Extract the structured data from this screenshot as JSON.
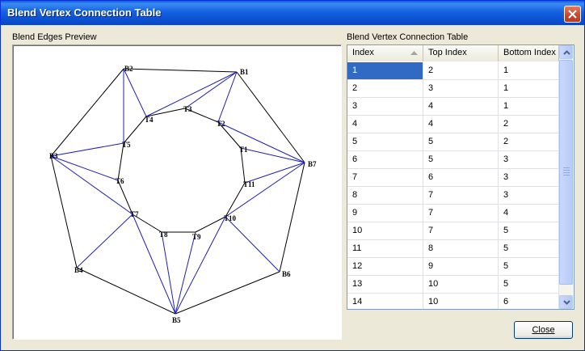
{
  "window": {
    "title": "Blend Vertex Connection Table",
    "close_icon": "close-icon"
  },
  "preview": {
    "label": "Blend Edges Preview",
    "bottom_vertices": [
      "B1",
      "B2",
      "B3",
      "B4",
      "B5",
      "B6",
      "B7"
    ],
    "top_vertices": [
      "T1",
      "T2",
      "T3",
      "T4",
      "T5",
      "T6",
      "T7",
      "T8",
      "T9",
      "T10",
      "T11"
    ],
    "colors": {
      "outline": "#000000",
      "connection": "#1f1fb8"
    }
  },
  "table": {
    "label": "Blend Vertex Connection Table",
    "columns": [
      "Index",
      "Top Index",
      "Bottom Index"
    ],
    "sort_icon": "sort-ascending-icon",
    "selected_row": 0,
    "rows": [
      [
        "1",
        "2",
        "1"
      ],
      [
        "2",
        "3",
        "1"
      ],
      [
        "3",
        "4",
        "1"
      ],
      [
        "4",
        "4",
        "2"
      ],
      [
        "5",
        "5",
        "2"
      ],
      [
        "6",
        "5",
        "3"
      ],
      [
        "7",
        "6",
        "3"
      ],
      [
        "8",
        "7",
        "3"
      ],
      [
        "9",
        "7",
        "4"
      ],
      [
        "10",
        "7",
        "5"
      ],
      [
        "11",
        "8",
        "5"
      ],
      [
        "12",
        "9",
        "5"
      ],
      [
        "13",
        "10",
        "5"
      ],
      [
        "14",
        "10",
        "6"
      ]
    ]
  },
  "buttons": {
    "close_label": "Close"
  },
  "colors": {
    "titlebar": "#0b4fcf",
    "selection": "#316ac5",
    "dialog": "#ece9d8"
  }
}
